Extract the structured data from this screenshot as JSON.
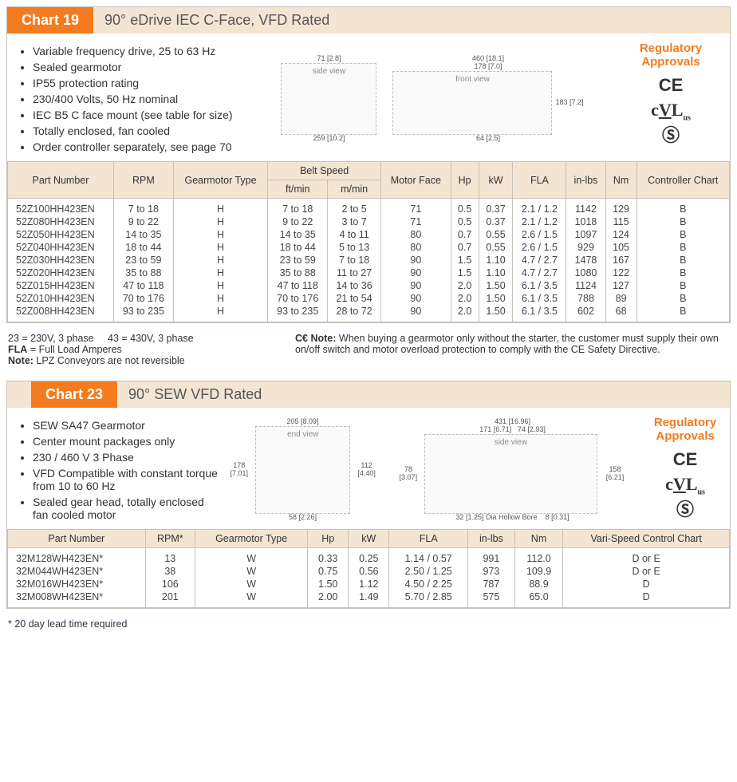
{
  "chart19": {
    "tab": "Chart 19",
    "title": "90° eDrive IEC C-Face, VFD Rated",
    "bullets": [
      "Variable frequency drive, 25 to 63 Hz",
      "Sealed gearmotor",
      "IP55 protection rating",
      "230/400 Volts, 50 Hz nominal",
      "IEC B5 C face mount (see table for size)",
      "Totally enclosed, fan cooled",
      "Order controller separately, see page 70"
    ],
    "reg_title": "Regulatory Approvals",
    "dims": {
      "w1": "259 [10.2]",
      "h1": "71 [2.8]",
      "w2": "460 [18.1]",
      "w3": "178 [7.0]",
      "h2": "64 [2.5]",
      "h3": "183 [7.2]"
    },
    "headers": {
      "part": "Part Number",
      "rpm": "RPM",
      "gtype": "Gearmotor Type",
      "belt": "Belt Speed",
      "belt_ft": "ft/min",
      "belt_m": "m/min",
      "face": "Motor Face",
      "hp": "Hp",
      "kw": "kW",
      "fla": "FLA",
      "inlbs": "in-lbs",
      "nm": "Nm",
      "cc": "Controller Chart"
    },
    "rows": [
      {
        "part": "52Z100HH423EN",
        "rpm": "7 to 18",
        "gtype": "H",
        "ft": "7 to 18",
        "m": "2 to 5",
        "face": "71",
        "hp": "0.5",
        "kw": "0.37",
        "fla": "2.1 / 1.2",
        "inlbs": "1142",
        "nm": "129",
        "cc": "B"
      },
      {
        "part": "52Z080HH423EN",
        "rpm": "9 to 22",
        "gtype": "H",
        "ft": "9 to 22",
        "m": "3 to 7",
        "face": "71",
        "hp": "0.5",
        "kw": "0.37",
        "fla": "2.1 / 1.2",
        "inlbs": "1018",
        "nm": "115",
        "cc": "B"
      },
      {
        "part": "52Z050HH423EN",
        "rpm": "14 to 35",
        "gtype": "H",
        "ft": "14 to 35",
        "m": "4 to 11",
        "face": "80",
        "hp": "0.7",
        "kw": "0.55",
        "fla": "2.6 / 1.5",
        "inlbs": "1097",
        "nm": "124",
        "cc": "B"
      },
      {
        "part": "52Z040HH423EN",
        "rpm": "18 to 44",
        "gtype": "H",
        "ft": "18 to 44",
        "m": "5 to 13",
        "face": "80",
        "hp": "0.7",
        "kw": "0.55",
        "fla": "2.6 / 1.5",
        "inlbs": "929",
        "nm": "105",
        "cc": "B"
      },
      {
        "part": "52Z030HH423EN",
        "rpm": "23 to 59",
        "gtype": "H",
        "ft": "23 to 59",
        "m": "7 to 18",
        "face": "90",
        "hp": "1.5",
        "kw": "1.10",
        "fla": "4.7 / 2.7",
        "inlbs": "1478",
        "nm": "167",
        "cc": "B"
      },
      {
        "part": "52Z020HH423EN",
        "rpm": "35 to 88",
        "gtype": "H",
        "ft": "35 to 88",
        "m": "11 to 27",
        "face": "90",
        "hp": "1.5",
        "kw": "1.10",
        "fla": "4.7 / 2.7",
        "inlbs": "1080",
        "nm": "122",
        "cc": "B"
      },
      {
        "part": "52Z015HH423EN",
        "rpm": "47 to 118",
        "gtype": "H",
        "ft": "47 to 118",
        "m": "14 to 36",
        "face": "90",
        "hp": "2.0",
        "kw": "1.50",
        "fla": "6.1 / 3.5",
        "inlbs": "1124",
        "nm": "127",
        "cc": "B"
      },
      {
        "part": "52Z010HH423EN",
        "rpm": "70 to 176",
        "gtype": "H",
        "ft": "70 to 176",
        "m": "21 to 54",
        "face": "90",
        "hp": "2.0",
        "kw": "1.50",
        "fla": "6.1 / 3.5",
        "inlbs": "788",
        "nm": "89",
        "cc": "B"
      },
      {
        "part": "52Z008HH423EN",
        "rpm": "93 to 235",
        "gtype": "H",
        "ft": "93 to 235",
        "m": "28 to 72",
        "face": "90",
        "hp": "2.0",
        "kw": "1.50",
        "fla": "6.1 / 3.5",
        "inlbs": "602",
        "nm": "68",
        "cc": "B"
      }
    ],
    "notes_left_1": "23 = 230V, 3 phase     43 = 430V, 3 phase",
    "notes_left_2": "FLA = Full Load Amperes",
    "notes_left_3": "Note:  LPZ Conveyors are not reversible",
    "notes_right": "Note:  When buying a gearmotor only without the starter, the customer must supply their own on/off switch and motor overload protection to comply with the CE Safety Directive.",
    "ce_prefix": "CE"
  },
  "chart23": {
    "tab": "Chart 23",
    "title": "90° SEW VFD Rated",
    "bullets": [
      "SEW SA47 Gearmotor",
      "Center mount packages only",
      "230 / 460 V 3 Phase",
      "VFD Compatible with constant torque from 10 to 60 Hz",
      "Sealed gear head, totally enclosed fan cooled motor"
    ],
    "reg_title": "Regulatory Approvals",
    "dims": {
      "w1": "205 [8.09]",
      "h1": "178 [7.01]",
      "h2": "112 [4.40]",
      "b1": "58 [2.26]",
      "w2": "431 [16.96]",
      "w3": "171 [6.71]",
      "w4": "74 [2.93]",
      "h3": "78 [3.07]",
      "h4": "158 [6.21]",
      "b2": "8 [0.31]",
      "bore": "32 [1.25] Dia Hollow Bore"
    },
    "headers": {
      "part": "Part Number",
      "rpm": "RPM*",
      "gtype": "Gearmotor Type",
      "hp": "Hp",
      "kw": "kW",
      "fla": "FLA",
      "inlbs": "in-lbs",
      "nm": "Nm",
      "cc": "Vari-Speed Control Chart"
    },
    "rows": [
      {
        "part": "32M128WH423EN*",
        "rpm": "13",
        "gtype": "W",
        "hp": "0.33",
        "kw": "0.25",
        "fla": "1.14 / 0.57",
        "inlbs": "991",
        "nm": "112.0",
        "cc": "D or E"
      },
      {
        "part": "32M044WH423EN*",
        "rpm": "38",
        "gtype": "W",
        "hp": "0.75",
        "kw": "0.56",
        "fla": "2.50 / 1.25",
        "inlbs": "973",
        "nm": "109.9",
        "cc": "D or E"
      },
      {
        "part": "32M016WH423EN*",
        "rpm": "106",
        "gtype": "W",
        "hp": "1.50",
        "kw": "1.12",
        "fla": "4.50 / 2.25",
        "inlbs": "787",
        "nm": "88.9",
        "cc": "D"
      },
      {
        "part": "32M008WH423EN*",
        "rpm": "201",
        "gtype": "W",
        "hp": "2.00",
        "kw": "1.49",
        "fla": "5.70 / 2.85",
        "inlbs": "575",
        "nm": "65.0",
        "cc": "D"
      }
    ],
    "footnote": "* 20 day lead time required"
  }
}
